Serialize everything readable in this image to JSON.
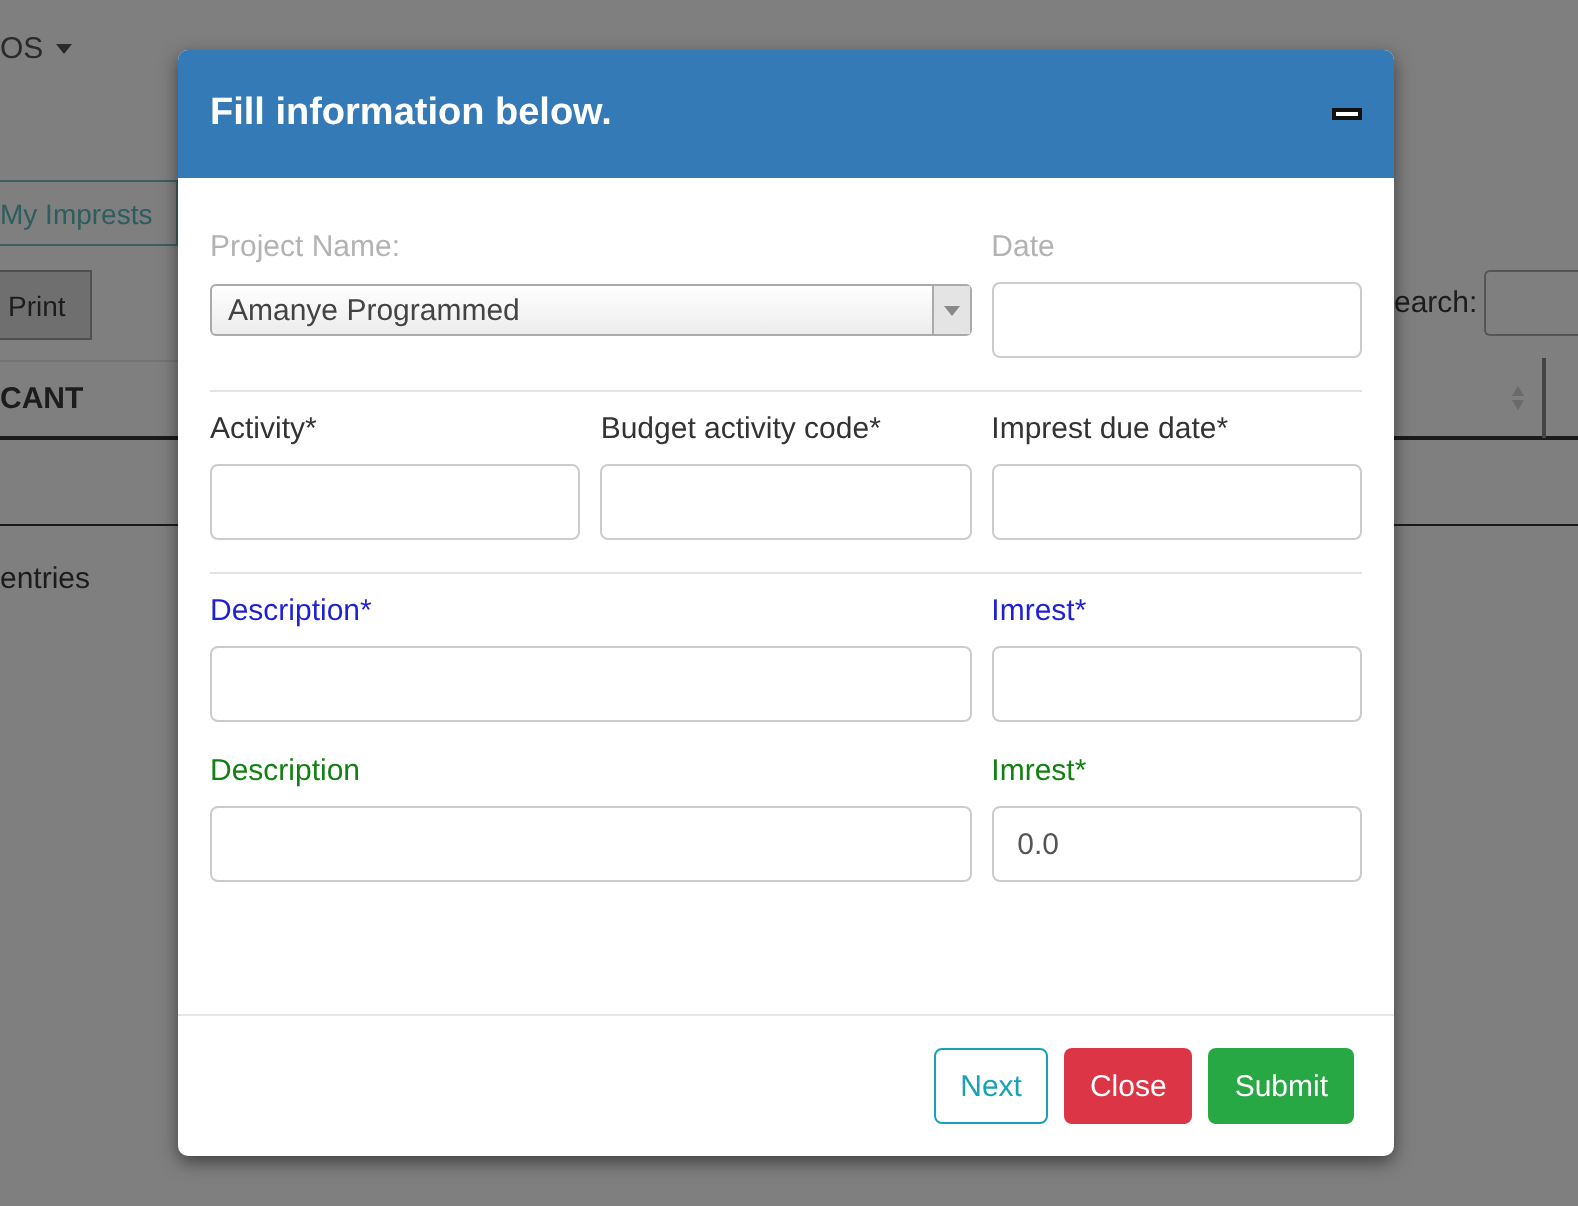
{
  "background": {
    "nav_menu": "OS",
    "tab": {
      "label": "My Imprests",
      "selected": true
    },
    "print_button": "Print",
    "table_header": "CANT",
    "entries_text": "entries",
    "search_label": "earch:"
  },
  "modal": {
    "title": "Fill information below.",
    "sections": [
      {
        "rows": [
          {
            "fields": [
              {
                "label": "Project Name:",
                "kind": "select",
                "value": "Amanye Programmed",
                "color": "#b3b3b3"
              },
              {
                "label": "Date",
                "kind": "input",
                "color": "#b3b3b3"
              }
            ]
          }
        ]
      },
      {
        "rows": [
          {
            "fields": [
              {
                "label": "Activity*",
                "kind": "input",
                "color": "#333333"
              },
              {
                "label": "Budget activity code*",
                "kind": "input",
                "color": "#333333"
              },
              {
                "label": "Imprest due date*",
                "kind": "input",
                "color": "#333333"
              }
            ]
          }
        ]
      },
      {
        "rows": [
          {
            "fields": [
              {
                "label": "Description*",
                "kind": "wide_input",
                "color": "#1f1fd6"
              },
              {
                "label": "Imrest*",
                "kind": "input",
                "color": "#1f1fd6"
              }
            ]
          },
          {
            "fields": [
              {
                "label": "Description",
                "kind": "wide_input",
                "color": "#138013"
              },
              {
                "label": "Imrest*",
                "kind": "input",
                "value": "0.0",
                "color": "#138013"
              }
            ]
          }
        ]
      }
    ],
    "buttons": [
      {
        "label": "Next",
        "kind": "outline"
      },
      {
        "label": "Close",
        "kind": "danger"
      },
      {
        "label": "Submit",
        "kind": "success"
      }
    ]
  }
}
